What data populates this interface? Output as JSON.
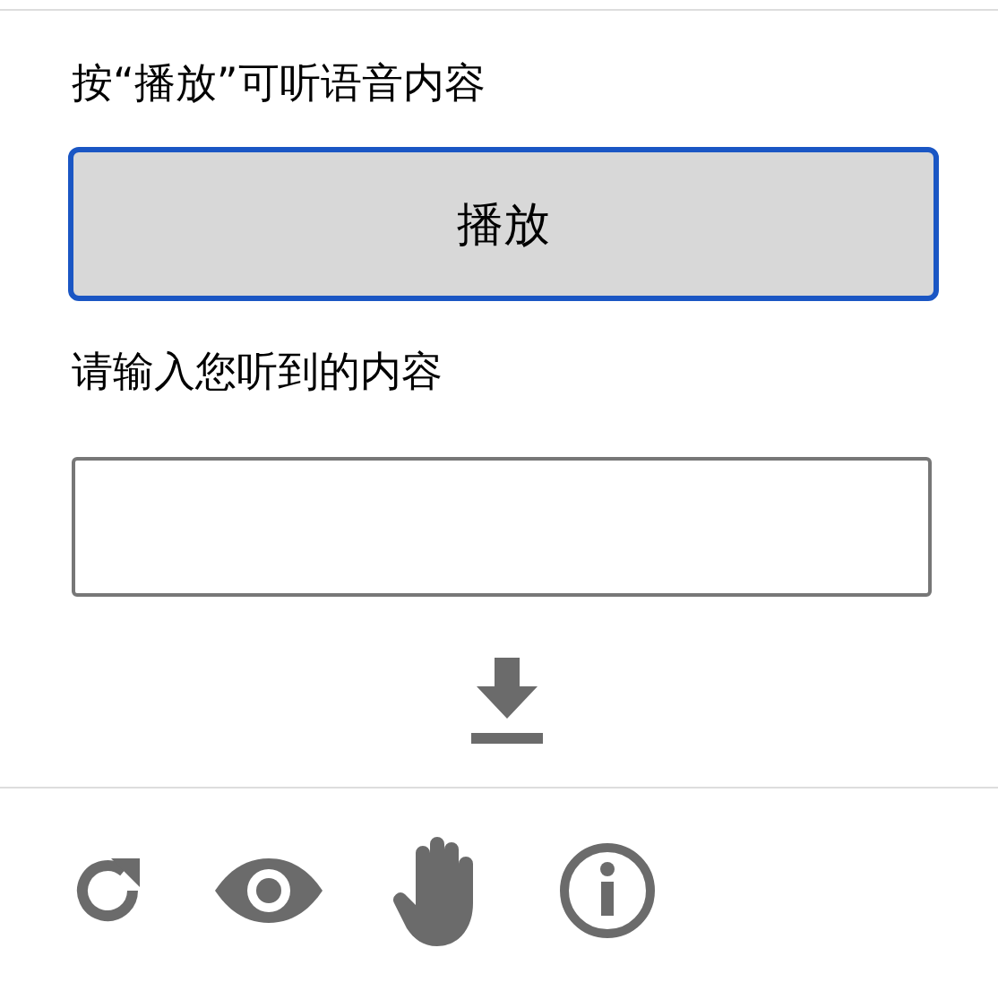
{
  "instruction": "按“播放”可听语音内容",
  "play_button": {
    "label": "播放"
  },
  "answer_label": "请输入您听到的内容"
}
